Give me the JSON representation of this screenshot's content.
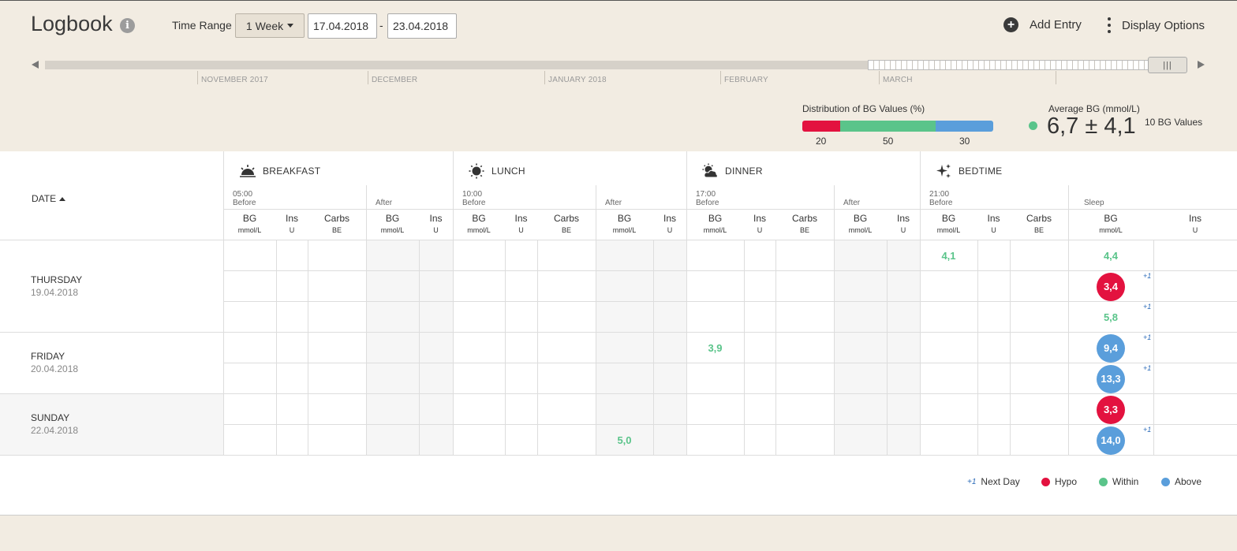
{
  "header": {
    "title": "Logbook",
    "info_icon": "i",
    "time_range_label": "Time Range",
    "time_range_value": "1 Week",
    "date_from": "17.04.2018",
    "date_separator": "-",
    "date_to": "23.04.2018",
    "add_entry_label": "Add Entry",
    "display_options_label": "Display Options"
  },
  "timeline": {
    "months": [
      "NOVEMBER 2017",
      "DECEMBER",
      "JANUARY 2018",
      "FEBRUARY",
      "MARCH"
    ],
    "handle_glyph": "|||"
  },
  "stats": {
    "distribution_label": "Distribution of BG Values (%)",
    "distribution": [
      {
        "name": "Hypo",
        "value": 20,
        "label": "20",
        "color": "#e3123f"
      },
      {
        "name": "Within",
        "value": 50,
        "label": "50",
        "color": "#5ac48a"
      },
      {
        "name": "Above",
        "value": 30,
        "label": "30",
        "color": "#5a9edb"
      }
    ],
    "average_label": "Average BG (mmol/L)",
    "average_value": "6,7 ± 4,1",
    "bg_count": "10 BG Values"
  },
  "table": {
    "date_header": "DATE",
    "meals": [
      {
        "name": "BREAKFAST",
        "icon": "sunrise-icon",
        "before_time": "05:00",
        "before_label": "Before",
        "after_label": "After"
      },
      {
        "name": "LUNCH",
        "icon": "sun-icon",
        "before_time": "10:00",
        "before_label": "Before",
        "after_label": "After"
      },
      {
        "name": "DINNER",
        "icon": "sun-cloud-icon",
        "before_time": "17:00",
        "before_label": "Before",
        "after_label": "After"
      },
      {
        "name": "BEDTIME",
        "icon": "stars-icon",
        "before_time": "21:00",
        "before_label": "Before",
        "after_label": "Sleep"
      }
    ],
    "columns": {
      "bg": "BG",
      "bg_unit": "mmol/L",
      "ins": "Ins",
      "ins_unit": "U",
      "carbs": "Carbs",
      "carbs_unit": "BE"
    },
    "days": [
      {
        "name": "THURSDAY",
        "date": "19.04.2018"
      },
      {
        "name": "FRIDAY",
        "date": "20.04.2018"
      },
      {
        "name": "SUNDAY",
        "date": "22.04.2018"
      }
    ],
    "readings": [
      {
        "row": 0,
        "slot": "bedtime-before",
        "value": "4,1",
        "status": "within",
        "next_day": false
      },
      {
        "row": 0,
        "slot": "sleep",
        "value": "4,4",
        "status": "within",
        "next_day": false
      },
      {
        "row": 1,
        "slot": "sleep",
        "value": "3,4",
        "status": "hypo",
        "next_day": true
      },
      {
        "row": 2,
        "slot": "sleep",
        "value": "5,8",
        "status": "within",
        "next_day": true
      },
      {
        "row": 3,
        "slot": "dinner-before",
        "value": "3,9",
        "status": "within",
        "next_day": false
      },
      {
        "row": 3,
        "slot": "sleep",
        "value": "9,4",
        "status": "above",
        "next_day": true
      },
      {
        "row": 4,
        "slot": "sleep",
        "value": "13,3",
        "status": "above",
        "next_day": true
      },
      {
        "row": 5,
        "slot": "sleep",
        "value": "3,3",
        "status": "hypo",
        "next_day": false
      },
      {
        "row": 6,
        "slot": "lunch-after",
        "value": "5,0",
        "status": "within",
        "next_day": false
      },
      {
        "row": 6,
        "slot": "sleep",
        "value": "14,0",
        "status": "above",
        "next_day": true
      }
    ],
    "next_day_marker": "+1"
  },
  "legend": {
    "next_day_marker": "+1",
    "next_day_label": "Next Day",
    "hypo_label": "Hypo",
    "within_label": "Within",
    "above_label": "Above"
  },
  "colors": {
    "hypo": "#e3123f",
    "within": "#5ac48a",
    "above": "#5a9edb",
    "background": "#f2ece2"
  }
}
